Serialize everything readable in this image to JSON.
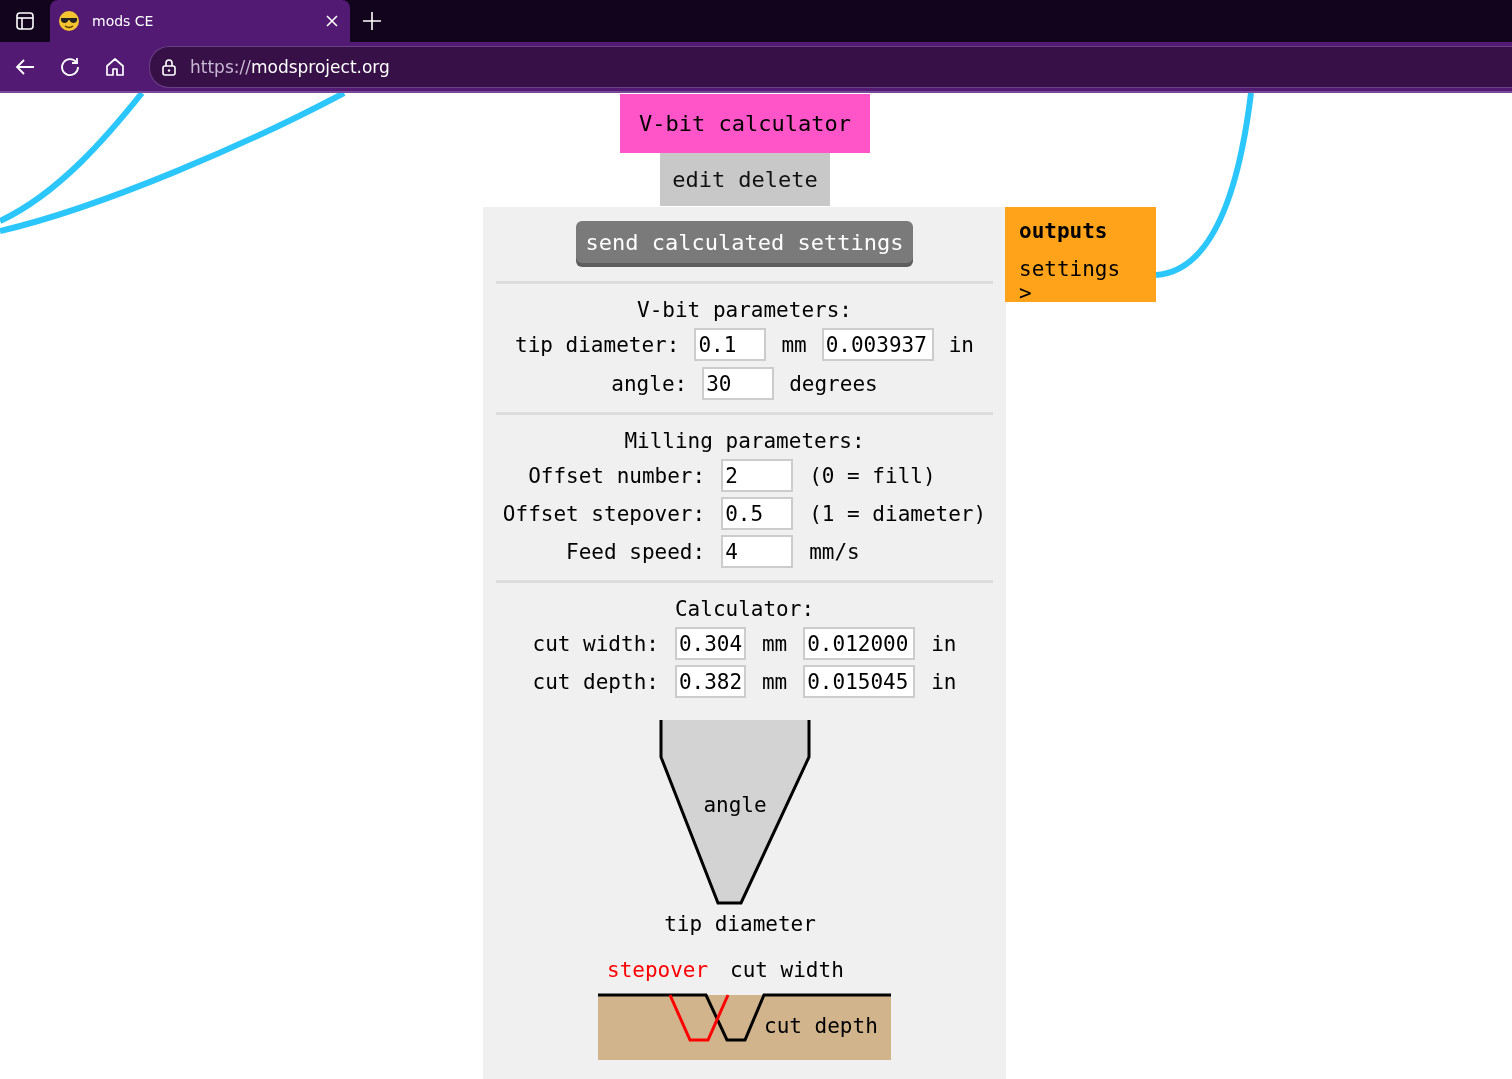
{
  "browser": {
    "tab_title": "mods CE",
    "url_scheme": "https://",
    "url_host": "modsproject.org"
  },
  "module": {
    "title": "V-bit calculator",
    "actions": [
      "edit",
      "delete"
    ],
    "send_button": "send calculated settings",
    "vbit": {
      "heading": "V-bit parameters:",
      "tip_label": "tip diameter:",
      "tip_mm": "0.1",
      "mm_unit": "mm",
      "tip_in": "0.003937",
      "in_unit": "in",
      "angle_label": "angle:",
      "angle": "30",
      "angle_unit": "degrees"
    },
    "milling": {
      "heading": "Milling parameters:",
      "rows": [
        {
          "label": "Offset number:",
          "value": "2",
          "note": "(0 = fill)"
        },
        {
          "label": "Offset stepover:",
          "value": "0.5",
          "note": "(1 = diameter)"
        },
        {
          "label": "Feed speed:",
          "value": "4",
          "note": "mm/s"
        }
      ]
    },
    "calculator": {
      "heading": "Calculator:",
      "rows": [
        {
          "label": "cut width:",
          "mm": "0.304",
          "mm_unit": "mm",
          "in": "0.012000",
          "in_unit": "in"
        },
        {
          "label": "cut depth:",
          "mm": "0.382",
          "mm_unit": "mm",
          "in": "0.015045",
          "in_unit": "in"
        }
      ]
    },
    "diagram": {
      "angle_label": "angle",
      "tip_label": "tip diameter",
      "stepover_label": "stepover",
      "cut_width_label": "cut width",
      "cut_depth_label": "cut depth"
    }
  },
  "outputs": {
    "heading": "outputs",
    "items": [
      {
        "label": "settings",
        "arrow": ">"
      }
    ]
  }
}
